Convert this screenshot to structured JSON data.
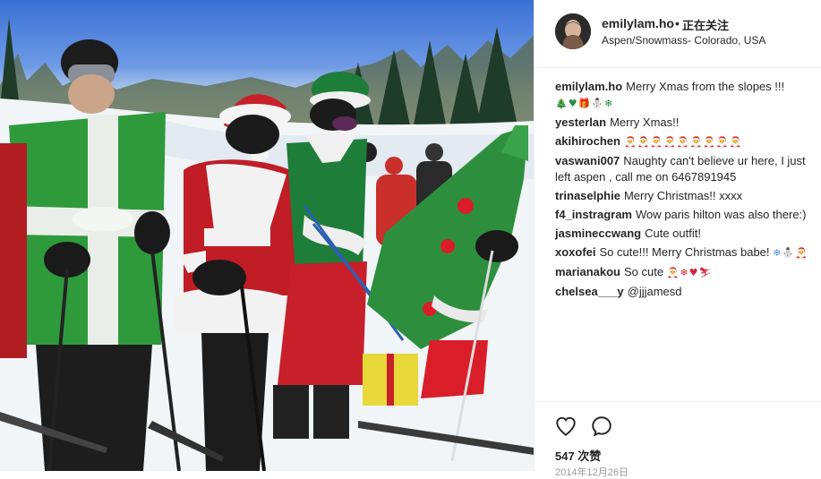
{
  "post": {
    "photo_alt": "Skiers dressed as Christmas presents, Santa elves and a tree on a ski slope"
  },
  "header": {
    "username": "emilylam.ho",
    "separator": "•",
    "follow_label": "正在关注",
    "location": "Aspen/Snowmass- Colorado, USA"
  },
  "comments": [
    {
      "user": "emilylam.ho",
      "text": "Merry Xmas from the slopes !!!"
    },
    {
      "user": "yesterlan",
      "text": "Merry Xmas!!"
    },
    {
      "user": "akihirochen",
      "text": ""
    },
    {
      "user": "vaswani007",
      "text": "Naughty can't believe ur here, I just left aspen , call me on 6467891945"
    },
    {
      "user": "trinaselphie",
      "text": "Merry Christmas!! xxxx"
    },
    {
      "user": "f4_instragram",
      "text": "Wow paris hilton was also there:)"
    },
    {
      "user": "jasmineccwang",
      "text": "Cute outfit!"
    },
    {
      "user": "xoxofei",
      "text": "So cute!!! Merry Christmas babe!"
    },
    {
      "user": "marianakou",
      "text": "So cute"
    },
    {
      "user": "chelsea___y",
      "text": "@jjjamesd"
    }
  ],
  "emojis": {
    "caption": "🎄♥🎁⛄❄",
    "akihirochen": "🎅🎅🎅🎅🎅🎅🎅🎅🎅",
    "xoxofei": "❄⛄🎅",
    "marianakou": "🎅❄♥⛷"
  },
  "actions": {
    "like_icon": "heart-icon",
    "comment_icon": "comment-bubble-icon",
    "likes_text": "547 次赞",
    "date_text": "2014年12月26日"
  }
}
